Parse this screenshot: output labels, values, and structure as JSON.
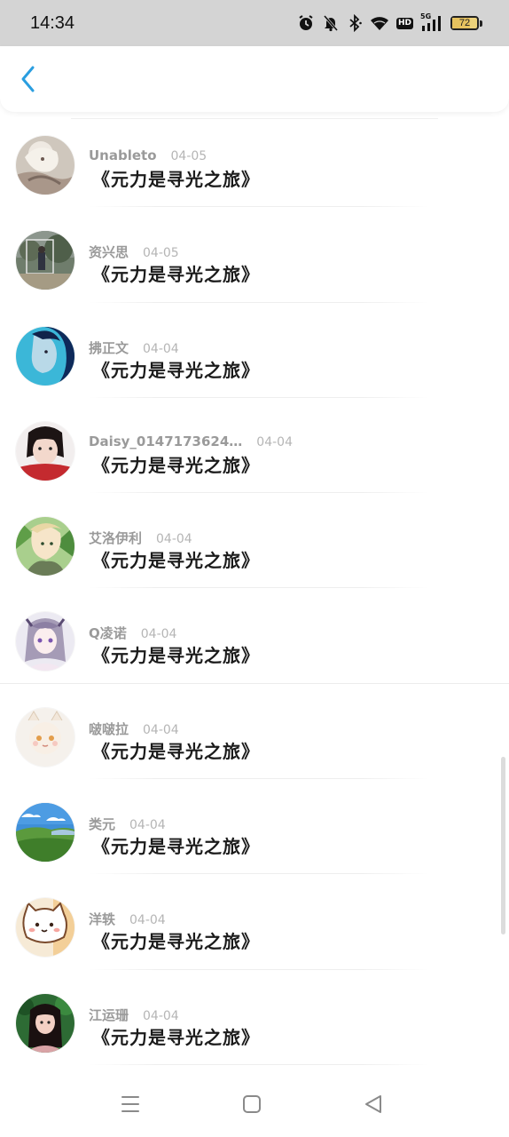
{
  "status_bar": {
    "time": "14:34",
    "network_label": "5G",
    "hd_label": "HD",
    "battery_percent": 72,
    "battery_label": "72",
    "icons": [
      "alarm-icon",
      "mute-icon",
      "bluetooth-icon",
      "wifi-icon",
      "hd-icon",
      "signal-5g-icon",
      "battery-icon"
    ]
  },
  "header": {
    "back_icon": "chevron-left-icon",
    "accent_color": "#2a9ee0"
  },
  "items": [
    {
      "username": "Unableto",
      "date": "04-05",
      "title": "《元力是寻光之旅》",
      "avatar": "anime-girl-sepia"
    },
    {
      "username": "资兴思",
      "date": "04-05",
      "title": "《元力是寻光之旅》",
      "avatar": "person-outdoor-tree"
    },
    {
      "username": "拂正文",
      "date": "04-04",
      "title": "《元力是寻光之旅》",
      "avatar": "girl-cyan-portrait"
    },
    {
      "username": "Daisy_0147173624…",
      "date": "04-04",
      "title": "《元力是寻光之旅》",
      "avatar": "child-red-portrait"
    },
    {
      "username": "艾洛伊利",
      "date": "04-04",
      "title": "《元力是寻光之旅》",
      "avatar": "anime-girl-green"
    },
    {
      "username": "Q凌诺",
      "date": "04-04",
      "title": "《元力是寻光之旅》",
      "avatar": "anime-girl-purple"
    },
    {
      "username": "啵啵拉",
      "date": "04-04",
      "title": "《元力是寻光之旅》",
      "avatar": "anime-cat-girl-light"
    },
    {
      "username": "类元",
      "date": "04-04",
      "title": "《元力是寻光之旅》",
      "avatar": "green-hills-landscape"
    },
    {
      "username": "洋轶",
      "date": "04-04",
      "title": "《元力是寻光之旅》",
      "avatar": "cartoon-cat-bear"
    },
    {
      "username": "江运珊",
      "date": "04-04",
      "title": "《元力是寻光之旅》",
      "avatar": "girl-green-background"
    }
  ],
  "nav_bar": {
    "icons": [
      "menu-icon",
      "home-icon",
      "back-triangle-icon"
    ]
  }
}
